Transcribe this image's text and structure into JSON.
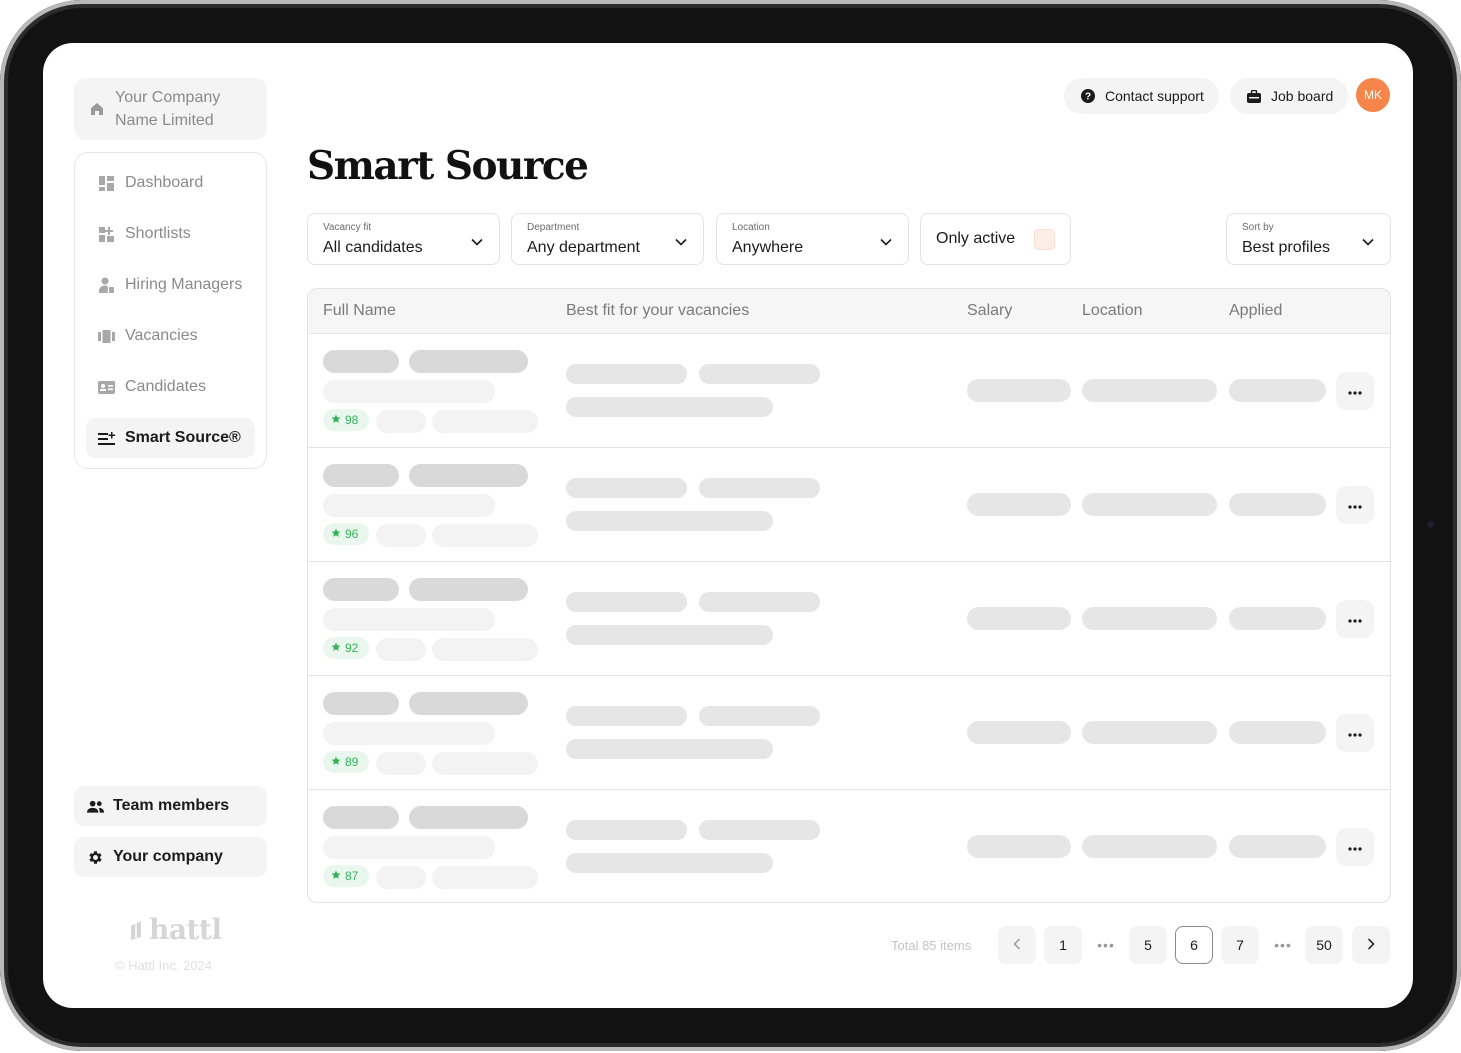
{
  "sidebar": {
    "company_name": "Your Company Name Limited",
    "items": [
      {
        "label": "Dashboard",
        "icon": "dashboard-icon"
      },
      {
        "label": "Shortlists",
        "icon": "shortlists-icon"
      },
      {
        "label": "Hiring Managers",
        "icon": "hiring-managers-icon"
      },
      {
        "label": "Vacancies",
        "icon": "vacancies-icon"
      },
      {
        "label": "Candidates",
        "icon": "candidates-icon"
      },
      {
        "label": "Smart Source®",
        "icon": "smart-source-icon",
        "active": true
      }
    ],
    "team_members": "Team members",
    "your_company": "Your company",
    "brand": "hattl",
    "copyright": "© Hattl Inc. 2024"
  },
  "header": {
    "contact_support": "Contact support",
    "job_board": "Job board",
    "avatar_initials": "MK"
  },
  "page": {
    "title": "Smart Source"
  },
  "filters": {
    "vacancy_fit": {
      "caption": "Vacancy fit",
      "value": "All candidates"
    },
    "department": {
      "caption": "Department",
      "value": "Any department"
    },
    "location": {
      "caption": "Location",
      "value": "Anywhere"
    },
    "only_active": "Only active",
    "sort_by": {
      "caption": "Sort by",
      "value": "Best profiles"
    }
  },
  "table": {
    "columns": [
      "Full Name",
      "Best fit for your vacancies",
      "Salary",
      "Location",
      "Applied"
    ],
    "rows": [
      {
        "score": "98"
      },
      {
        "score": "96"
      },
      {
        "score": "92"
      },
      {
        "score": "89"
      },
      {
        "score": "87"
      }
    ]
  },
  "pagination": {
    "total": "Total 85 items",
    "pages": [
      "1",
      "5",
      "6",
      "7",
      "50"
    ],
    "ellipsis": "•••",
    "current": "6"
  },
  "colors": {
    "accent": "#f5854a",
    "score_green": "#34b35a",
    "score_bg": "#eaf7ee"
  }
}
